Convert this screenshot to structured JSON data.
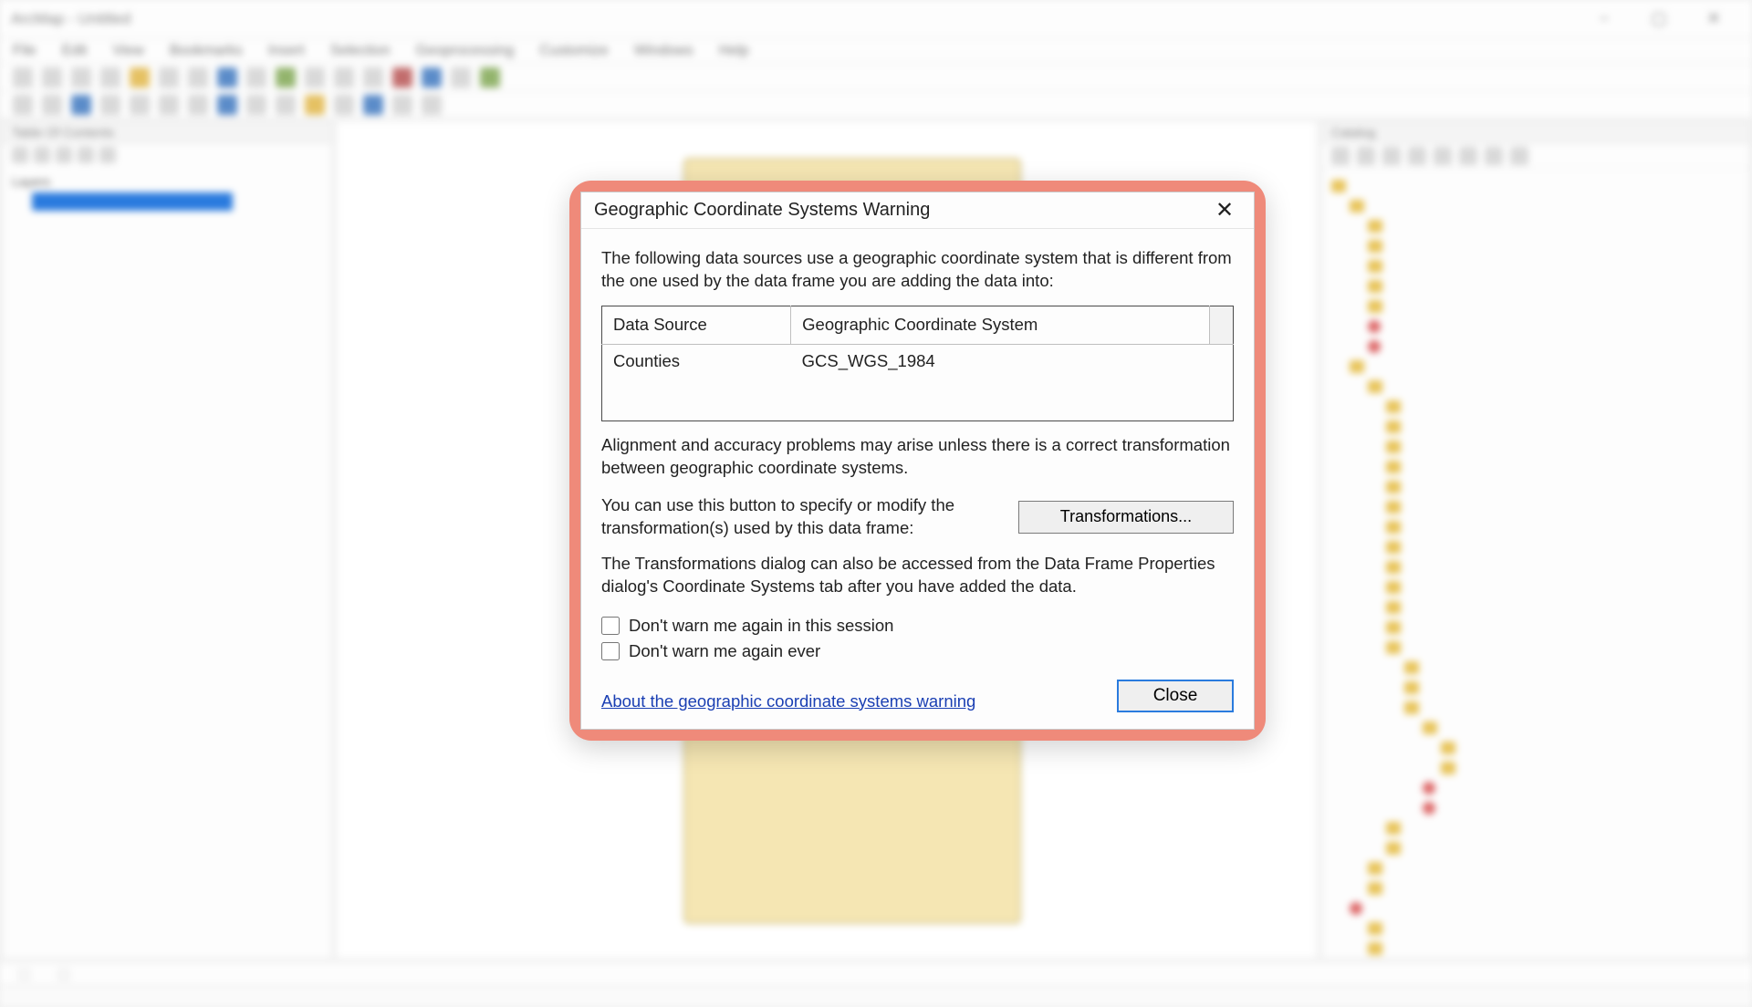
{
  "app": {
    "title": "ArcMap - Untitled",
    "menu": [
      "File",
      "Edit",
      "View",
      "Bookmarks",
      "Insert",
      "Selection",
      "Geoprocessing",
      "Customize",
      "Windows",
      "Help"
    ]
  },
  "toc": {
    "panel_title": "Table Of Contents",
    "root": "Layers"
  },
  "catalog": {
    "panel_title": "Catalog"
  },
  "statusbar": {
    "coords": ""
  },
  "dialog": {
    "title": "Geographic Coordinate Systems Warning",
    "msg1": "The following data sources use a geographic coordinate system that is different from the one used by the data frame you are adding the data into:",
    "table": {
      "headers": [
        "Data Source",
        "Geographic Coordinate System"
      ],
      "rows": [
        {
          "source": "Counties",
          "gcs": "GCS_WGS_1984"
        }
      ]
    },
    "msg2": "Alignment and accuracy problems may arise unless there is a correct transformation between geographic coordinate systems.",
    "transform_hint": "You can use this button to specify or modify the transformation(s) used by this data frame:",
    "transform_button": "Transformations...",
    "msg3": "The Transformations dialog can also be accessed from the Data Frame Properties dialog's Coordinate Systems tab after you have added the data.",
    "check_session": "Don't warn me again in this session",
    "check_ever": "Don't warn me again ever",
    "help_link": "About the geographic coordinate systems warning",
    "close_button": "Close"
  }
}
